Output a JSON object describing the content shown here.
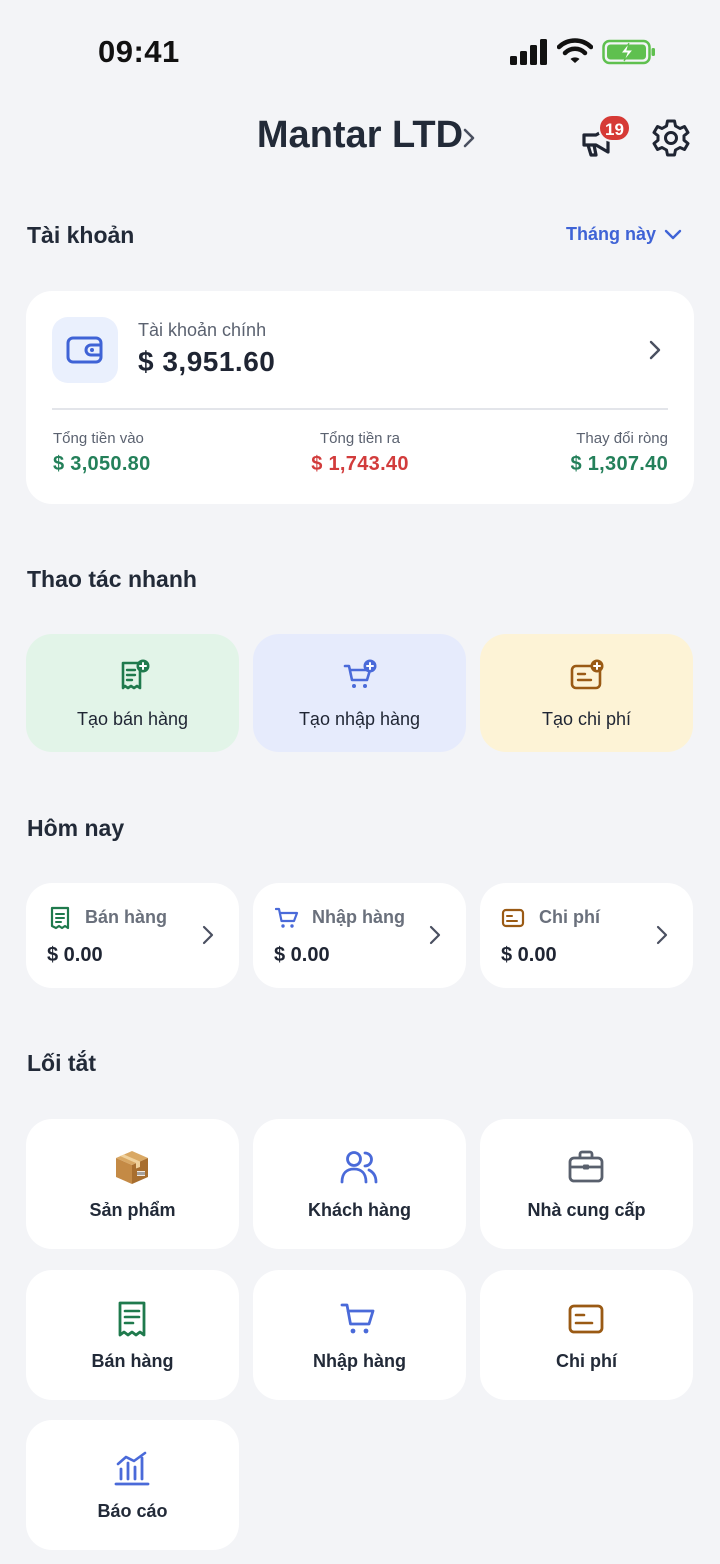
{
  "status_bar": {
    "time": "09:41"
  },
  "header": {
    "title": "Mantar LTD",
    "notification_count": "19"
  },
  "account_section": {
    "title": "Tài khoản",
    "period": "Tháng này",
    "card": {
      "label": "Tài khoản chính",
      "balance": "$ 3,951.60",
      "stats": [
        {
          "label": "Tổng tiền vào",
          "value": "$ 3,050.80"
        },
        {
          "label": "Tổng tiền ra",
          "value": "$ 1,743.40"
        },
        {
          "label": "Thay đổi ròng",
          "value": "$ 1,307.40"
        }
      ]
    }
  },
  "quick_actions": {
    "title": "Thao tác nhanh",
    "items": [
      {
        "label": "Tạo bán hàng",
        "icon": "receipt-add-icon",
        "bg": "#e2f4e8",
        "color": "#1f7a4d"
      },
      {
        "label": "Tạo nhập hàng",
        "icon": "cart-add-icon",
        "bg": "#e6ebfc",
        "color": "#4a6ad9"
      },
      {
        "label": "Tạo chi phí",
        "icon": "card-add-icon",
        "bg": "#fdf3d6",
        "color": "#9a5a14"
      }
    ]
  },
  "today": {
    "title": "Hôm nay",
    "items": [
      {
        "label": "Bán hàng",
        "value": "$ 0.00",
        "icon": "receipt-icon"
      },
      {
        "label": "Nhập hàng",
        "value": "$ 0.00",
        "icon": "cart-icon"
      },
      {
        "label": "Chi phí",
        "value": "$ 0.00",
        "icon": "card-icon"
      }
    ]
  },
  "shortcuts": {
    "title": "Lối tắt",
    "items": [
      {
        "label": "Sản phẩm",
        "icon": "package-icon"
      },
      {
        "label": "Khách hàng",
        "icon": "users-icon"
      },
      {
        "label": "Nhà cung cấp",
        "icon": "briefcase-icon"
      },
      {
        "label": "Bán hàng",
        "icon": "receipt-icon"
      },
      {
        "label": "Nhập hàng",
        "icon": "cart-icon"
      },
      {
        "label": "Chi phí",
        "icon": "card-icon"
      },
      {
        "label": "Báo cáo",
        "icon": "chart-icon"
      }
    ]
  },
  "colors": {
    "accent": "#3f63d6",
    "positive": "#24805a",
    "negative": "#d23c3c",
    "badge": "#d63a36"
  }
}
